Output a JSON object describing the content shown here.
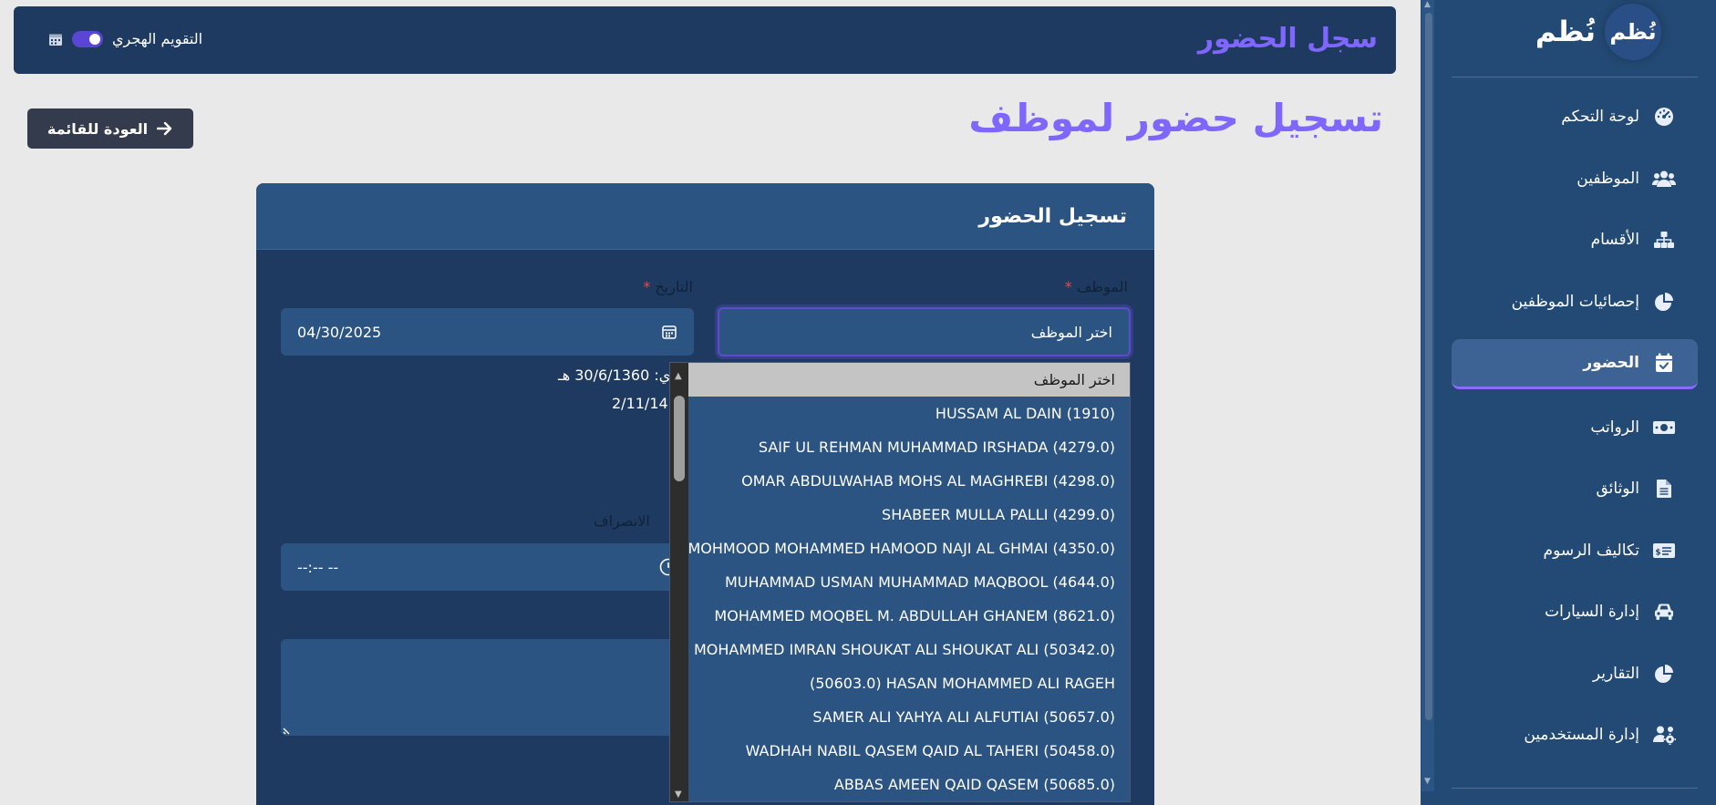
{
  "topbar": {
    "title": "سجل الحضور",
    "hijri_label": "التقويم الهجري"
  },
  "sidebar": {
    "brand": {
      "badge": "نُظم",
      "name": "نُظم"
    },
    "items": [
      {
        "label": "لوحة التحكم",
        "icon": "dashboard-icon"
      },
      {
        "label": "الموظفين",
        "icon": "users-icon"
      },
      {
        "label": "الأقسام",
        "icon": "sitemap-icon"
      },
      {
        "label": "إحصائيات الموظفين",
        "icon": "pie-chart-icon"
      },
      {
        "label": "الحضور",
        "icon": "calendar-check-icon",
        "active": true
      },
      {
        "label": "الرواتب",
        "icon": "money-icon"
      },
      {
        "label": "الوثائق",
        "icon": "document-icon"
      },
      {
        "label": "تكاليف الرسوم",
        "icon": "fee-card-icon"
      },
      {
        "label": "إدارة السيارات",
        "icon": "car-icon"
      },
      {
        "label": "التقارير",
        "icon": "pie-chart-icon"
      },
      {
        "label": "إدارة المستخدمين",
        "icon": "users-cog-icon"
      }
    ]
  },
  "page": {
    "title": "تسجيل حضور لموظف",
    "back_label": "العودة للقائمة"
  },
  "form": {
    "card_title": "تسجيل الحضور",
    "employee_label": "الموظف",
    "employee_placeholder": "اختر الموظف",
    "date_label": "التاريخ",
    "date_value": "04/30/2025",
    "hijri_line_1": "ري: 30/6/1360 هـ",
    "hijri_line_2": "2/11/14 هـ",
    "checkout_label": "الانصراف",
    "checkout_value": "--:-- --",
    "required_mark": "*"
  },
  "dropdown": {
    "options": [
      "اختر الموظف",
      "HUSSAM AL DAIN (1910)",
      "SAIF UL REHMAN MUHAMMAD IRSHADA (4279.0)",
      "OMAR ABDULWAHAB MOHS AL MAGHREBI (4298.0)",
      "SHABEER MULLA PALLI (4299.0)",
      "MOHMOOD MOHAMMED HAMOOD NAJI AL GHMAI (4350.0)",
      "MUHAMMAD USMAN MUHAMMAD MAQBOOL (4644.0)",
      "MOHAMMED MOQBEL M. ABDULLAH GHANEM (8621.0)",
      "MOHAMMED IMRAN SHOUKAT ALI SHOUKAT ALI (50342.0)",
      "(50603.0) HASAN MOHAMMED ALI RAGEH",
      "SAMER ALI YAHYA ALI ALFUTIAI (50657.0)",
      "WADHAH NABIL QASEM QAID AL TAHERI (50458.0)",
      "ABBAS AMEEN QAID QASEM (50685.0)"
    ]
  },
  "colors": {
    "accent": "#7f66ff",
    "topbar_bg": "#1f3a60",
    "sidebar_bg": "#234a74",
    "card_bg": "#1f3a60",
    "input_bg": "#2b5482",
    "required": "#e5484d"
  }
}
